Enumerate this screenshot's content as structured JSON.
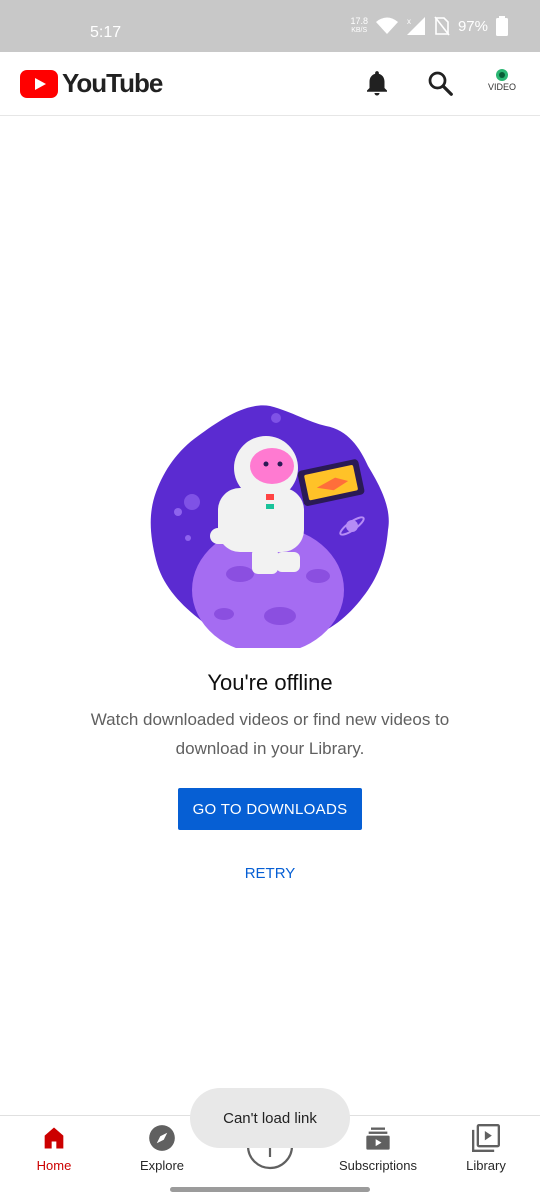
{
  "status_bar": {
    "time": "5:17",
    "net_speed_value": "17.8",
    "net_speed_unit": "KB/S",
    "battery": "97%"
  },
  "app_bar": {
    "logo_text": "YouTube",
    "avatar_label": "VIDEO",
    "icons": [
      "notifications-bell-icon",
      "search-icon",
      "account-avatar"
    ]
  },
  "main": {
    "title": "You're offline",
    "description": "Watch downloaded videos or find new videos to download in your Library.",
    "primary_button": "GO TO DOWNLOADS",
    "retry_button": "RETRY"
  },
  "toast": "Can't load link",
  "bottom_nav": {
    "items": [
      {
        "label": "Home",
        "icon": "home-icon",
        "active": true
      },
      {
        "label": "Explore",
        "icon": "compass-icon",
        "active": false
      },
      {
        "label": "",
        "icon": "create-plus-icon",
        "active": false
      },
      {
        "label": "Subscriptions",
        "icon": "subscriptions-icon",
        "active": false
      },
      {
        "label": "Library",
        "icon": "library-icon",
        "active": false
      }
    ]
  },
  "colors": {
    "brand_red": "#ff0000",
    "accent_blue": "#065fd4",
    "status_bar_bg": "#c8c8c8"
  }
}
